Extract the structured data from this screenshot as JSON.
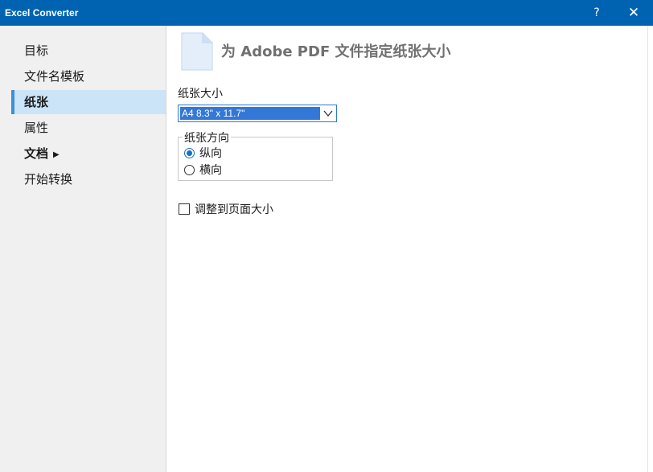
{
  "window": {
    "title": "Excel Converter",
    "help_label": "?",
    "close_label": "✕"
  },
  "sidebar": {
    "items": [
      {
        "label": "目标"
      },
      {
        "label": "文件名模板"
      },
      {
        "label": "纸张",
        "selected": true
      },
      {
        "label": "属性"
      },
      {
        "label": "文档",
        "has_submenu": true,
        "submenu_glyph": "▶"
      },
      {
        "label": "开始转换"
      }
    ]
  },
  "header": {
    "icon": "document-icon",
    "title": "为 Adobe PDF 文件指定纸张大小"
  },
  "paper_size": {
    "label": "纸张大小",
    "selected_value": "A4 8.3\" x 11.7\""
  },
  "orientation": {
    "legend": "纸张方向",
    "options": [
      {
        "label": "纵向",
        "checked": true
      },
      {
        "label": "横向",
        "checked": false
      }
    ]
  },
  "fit_to_page": {
    "label": "调整到页面大小",
    "checked": false
  },
  "colors": {
    "titlebar": "#0063b1",
    "selection": "#cce4f7",
    "accent": "#3378d6"
  }
}
